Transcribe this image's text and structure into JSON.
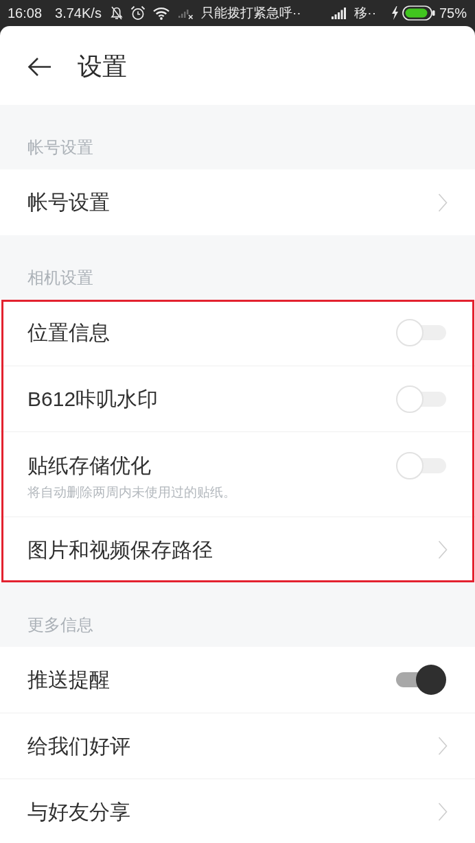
{
  "status_bar": {
    "time": "16:08",
    "network_speed": "3.74K/s",
    "sim1_status": "只能拨打紧急呼··",
    "sim2_operator": "移··",
    "battery": "75%"
  },
  "header": {
    "title": "设置"
  },
  "sections": [
    {
      "title": "帐号设置",
      "highlighted": false,
      "items": [
        {
          "kind": "link",
          "label": "帐号设置"
        }
      ]
    },
    {
      "title": "相机设置",
      "highlighted": true,
      "items": [
        {
          "kind": "toggle",
          "label": "位置信息",
          "on": false
        },
        {
          "kind": "toggle",
          "label": "B612咔叽水印",
          "on": false
        },
        {
          "kind": "toggle",
          "label": "贴纸存储优化",
          "description": "将自动删除两周内未使用过的贴纸。",
          "on": false
        },
        {
          "kind": "link",
          "label": "图片和视频保存路径"
        }
      ]
    },
    {
      "title": "更多信息",
      "highlighted": false,
      "items": [
        {
          "kind": "toggle",
          "label": "推送提醒",
          "on": true
        },
        {
          "kind": "link",
          "label": "给我们好评"
        },
        {
          "kind": "link",
          "label": "与好友分享"
        }
      ]
    }
  ]
}
